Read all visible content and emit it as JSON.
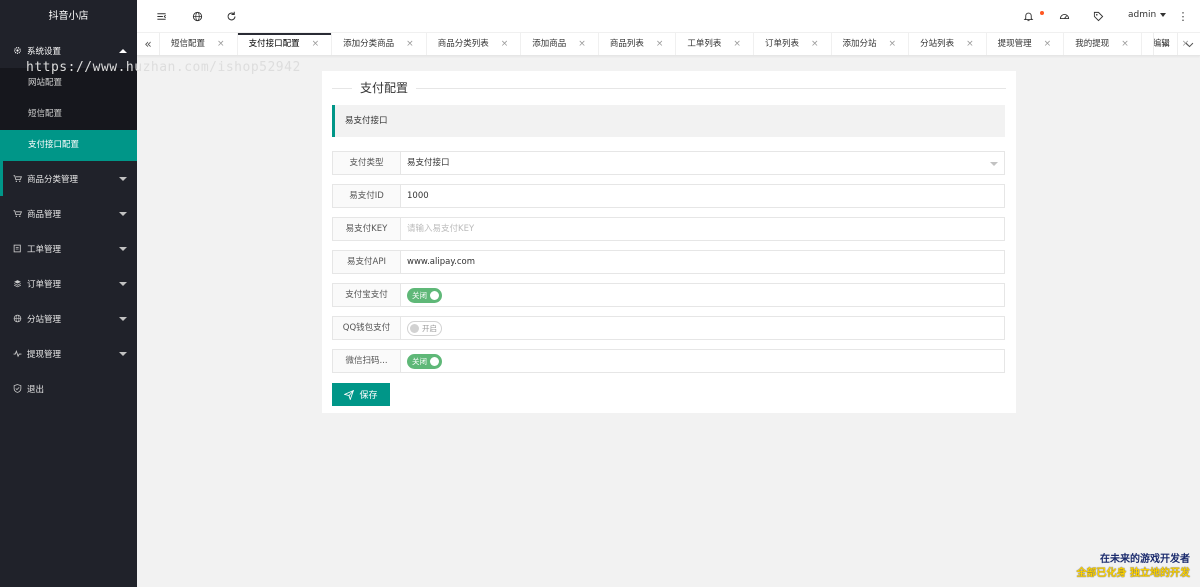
{
  "sidebar": {
    "logo": "抖音小店",
    "menu": [
      {
        "label": "系统设置",
        "icon": "gear-icon"
      },
      {
        "label": "商品分类管理",
        "icon": "cart-icon"
      },
      {
        "label": "商品管理",
        "icon": "cart-icon"
      },
      {
        "label": "工单管理",
        "icon": "ticket-icon"
      },
      {
        "label": "订单管理",
        "icon": "layers-icon"
      },
      {
        "label": "分站管理",
        "icon": "globe-icon"
      },
      {
        "label": "提现管理",
        "icon": "pulse-icon"
      },
      {
        "label": "退出",
        "icon": "shield-icon"
      }
    ],
    "submenu": [
      "网站配置",
      "短信配置",
      "支付接口配置"
    ],
    "active_sub": "支付接口配置"
  },
  "watermark": {
    "url": "https://www.huzhan.com/ishop52942",
    "corner_line1": "在未来的游戏开发者",
    "corner_line2": "全部已化身 独立地的开发"
  },
  "header": {
    "icons": [
      "menu-toggle-icon",
      "globe-icon",
      "refresh-icon",
      "bell-icon",
      "theme-icon",
      "tag-icon",
      "more-icon"
    ],
    "user": "admin",
    "more": "⋮"
  },
  "tabs": {
    "prev": "«",
    "next": "»",
    "dropdown": "⌄",
    "close": "×",
    "items": [
      {
        "label": "短信配置",
        "active": false
      },
      {
        "label": "支付接口配置",
        "active": true
      },
      {
        "label": "添加分类商品",
        "active": false
      },
      {
        "label": "商品分类列表",
        "active": false
      },
      {
        "label": "添加商品",
        "active": false
      },
      {
        "label": "商品列表",
        "active": false
      },
      {
        "label": "工单列表",
        "active": false
      },
      {
        "label": "订单列表",
        "active": false
      },
      {
        "label": "添加分站",
        "active": false
      },
      {
        "label": "分站列表",
        "active": false
      },
      {
        "label": "提现管理",
        "active": false
      },
      {
        "label": "我的提现",
        "active": false
      },
      {
        "label": "编辑",
        "active": false
      }
    ]
  },
  "form": {
    "title": "支付配置",
    "section": "易支付接口",
    "pay_type": {
      "label": "支付类型",
      "value": "易支付接口"
    },
    "pay_id": {
      "label": "易支付ID",
      "value": "1000"
    },
    "pay_key": {
      "label": "易支付KEY",
      "value": "",
      "placeholder": "请输入易支付KEY"
    },
    "pay_api": {
      "label": "易支付API",
      "value": "www.alipay.com"
    },
    "alipay": {
      "label": "支付宝支付",
      "state_text": "关闭",
      "on": true
    },
    "qqpay": {
      "label": "QQ钱包支付",
      "state_text": "开启",
      "on": false
    },
    "wxpay": {
      "label": "微信扫码...",
      "state_text": "关闭",
      "on": true
    },
    "save": "保存"
  },
  "colors": {
    "sidebar_bg": "#20222a",
    "accent": "#009688",
    "switch_on": "#5fb878"
  }
}
